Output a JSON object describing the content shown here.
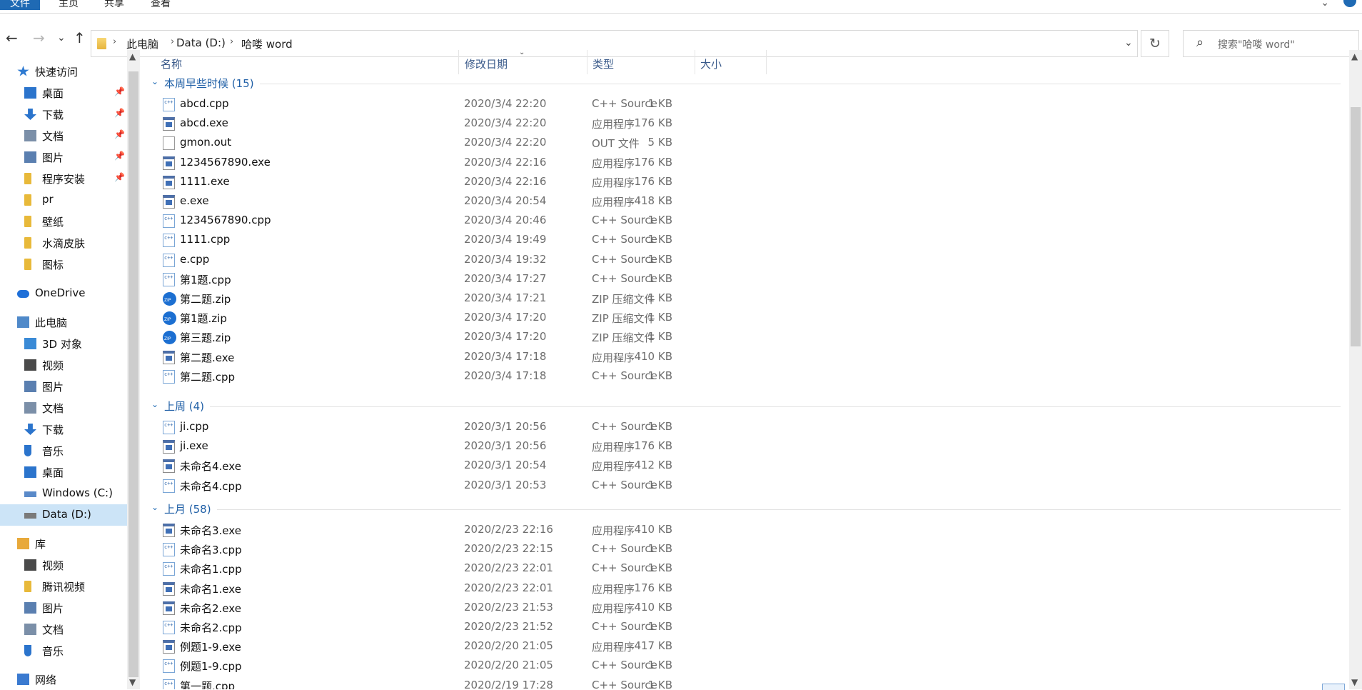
{
  "ribbon": {
    "tabs": [
      "文件",
      "主页",
      "共享",
      "查看"
    ],
    "expand_glyph": "⌄"
  },
  "nav": {
    "back": "←",
    "forward": "→",
    "recent": "⌄",
    "up": "↑",
    "breadcrumbs": [
      "此电脑",
      "Data (D:)",
      "哈喽 word"
    ],
    "separator": "›",
    "dropdown": "⌄",
    "refresh": "↻",
    "search_placeholder": "搜索\"哈喽 word\""
  },
  "navpane": {
    "scroll_up": "▲",
    "scroll_down": "▼",
    "items": [
      {
        "label": "快速访问",
        "icon": "star-icon",
        "level": 0,
        "color": "#2e7ad1"
      },
      {
        "label": "桌面",
        "icon": "desktop-icon",
        "level": 1,
        "pinned": true,
        "color": "#2b74cc"
      },
      {
        "label": "下载",
        "icon": "download-icon",
        "level": 1,
        "pinned": true,
        "color": "#2b74cc"
      },
      {
        "label": "文档",
        "icon": "document-icon",
        "level": 1,
        "pinned": true,
        "color": "#7b8fa8"
      },
      {
        "label": "图片",
        "icon": "picture-icon",
        "level": 1,
        "pinned": true,
        "color": "#5a7fb0"
      },
      {
        "label": "程序安装",
        "icon": "folder-icon",
        "level": 1,
        "pinned": true,
        "color": "#e8b93a"
      },
      {
        "label": "pr",
        "icon": "folder-icon",
        "level": 1,
        "color": "#e8b93a"
      },
      {
        "label": "壁纸",
        "icon": "folder-icon",
        "level": 1,
        "color": "#e8b93a"
      },
      {
        "label": "水滴皮肤",
        "icon": "folder-icon",
        "level": 1,
        "color": "#e8b93a"
      },
      {
        "label": "图标",
        "icon": "folder-icon",
        "level": 1,
        "color": "#e8b93a"
      },
      {
        "label": "OneDrive",
        "icon": "cloud-icon",
        "level": 0,
        "color": "#1e6fd8"
      },
      {
        "label": "此电脑",
        "icon": "computer-icon",
        "level": 0,
        "color": "#4f89c9"
      },
      {
        "label": "3D 对象",
        "icon": "cube-icon",
        "level": 1,
        "color": "#3a8ad6"
      },
      {
        "label": "视频",
        "icon": "video-icon",
        "level": 1,
        "color": "#4a4a4a"
      },
      {
        "label": "图片",
        "icon": "picture-icon",
        "level": 1,
        "color": "#5a7fb0"
      },
      {
        "label": "文档",
        "icon": "document-icon",
        "level": 1,
        "color": "#7b8fa8"
      },
      {
        "label": "下载",
        "icon": "download-icon",
        "level": 1,
        "color": "#2b74cc"
      },
      {
        "label": "音乐",
        "icon": "music-icon",
        "level": 1,
        "color": "#2b74cc"
      },
      {
        "label": "桌面",
        "icon": "desktop-icon",
        "level": 1,
        "color": "#2b74cc"
      },
      {
        "label": "Windows (C:)",
        "icon": "drive-icon",
        "level": 1,
        "color": "#5a8ac9"
      },
      {
        "label": "Data (D:)",
        "icon": "drive-icon",
        "level": 1,
        "selected": true,
        "color": "#7a7a7a"
      },
      {
        "label": "库",
        "icon": "library-icon",
        "level": 0,
        "color": "#e8a93a"
      },
      {
        "label": "视频",
        "icon": "video-icon",
        "level": 1,
        "color": "#4a4a4a"
      },
      {
        "label": "腾讯视频",
        "icon": "folder-icon",
        "level": 1,
        "color": "#e8b93a"
      },
      {
        "label": "图片",
        "icon": "picture-icon",
        "level": 1,
        "color": "#5a7fb0"
      },
      {
        "label": "文档",
        "icon": "document-icon",
        "level": 1,
        "color": "#7b8fa8"
      },
      {
        "label": "音乐",
        "icon": "music-icon",
        "level": 1,
        "color": "#2b74cc"
      },
      {
        "label": "网络",
        "icon": "network-icon",
        "level": 0,
        "color": "#3a7ad0"
      }
    ],
    "pin_glyph": "📌"
  },
  "columns": {
    "name": "名称",
    "date": "修改日期",
    "type": "类型",
    "size": "大小",
    "sort_glyph": "⌄"
  },
  "groups": [
    {
      "title": "本周早些时候 (15)",
      "chevron": "⌄",
      "files": [
        {
          "name": "abcd.cpp",
          "date": "2020/3/4 22:20",
          "type": "C++ Source",
          "size": "1 KB",
          "kind": "cpp"
        },
        {
          "name": "abcd.exe",
          "date": "2020/3/4 22:20",
          "type": "应用程序",
          "size": "176 KB",
          "kind": "exe"
        },
        {
          "name": "gmon.out",
          "date": "2020/3/4 22:20",
          "type": "OUT 文件",
          "size": "5 KB",
          "kind": "file"
        },
        {
          "name": "1234567890.exe",
          "date": "2020/3/4 22:16",
          "type": "应用程序",
          "size": "176 KB",
          "kind": "exe"
        },
        {
          "name": "1111.exe",
          "date": "2020/3/4 22:16",
          "type": "应用程序",
          "size": "176 KB",
          "kind": "exe"
        },
        {
          "name": "e.exe",
          "date": "2020/3/4 20:54",
          "type": "应用程序",
          "size": "418 KB",
          "kind": "exe"
        },
        {
          "name": "1234567890.cpp",
          "date": "2020/3/4 20:46",
          "type": "C++ Source",
          "size": "1 KB",
          "kind": "cpp"
        },
        {
          "name": "1111.cpp",
          "date": "2020/3/4 19:49",
          "type": "C++ Source",
          "size": "1 KB",
          "kind": "cpp"
        },
        {
          "name": "e.cpp",
          "date": "2020/3/4 19:32",
          "type": "C++ Source",
          "size": "1 KB",
          "kind": "cpp"
        },
        {
          "name": "第1题.cpp",
          "date": "2020/3/4 17:27",
          "type": "C++ Source",
          "size": "1 KB",
          "kind": "cpp"
        },
        {
          "name": "第二题.zip",
          "date": "2020/3/4 17:21",
          "type": "ZIP 压缩文件",
          "size": "1 KB",
          "kind": "zip"
        },
        {
          "name": "第1题.zip",
          "date": "2020/3/4 17:20",
          "type": "ZIP 压缩文件",
          "size": "1 KB",
          "kind": "zip"
        },
        {
          "name": "第三题.zip",
          "date": "2020/3/4 17:20",
          "type": "ZIP 压缩文件",
          "size": "1 KB",
          "kind": "zip"
        },
        {
          "name": "第二题.exe",
          "date": "2020/3/4 17:18",
          "type": "应用程序",
          "size": "410 KB",
          "kind": "exe"
        },
        {
          "name": "第二题.cpp",
          "date": "2020/3/4 17:18",
          "type": "C++ Source",
          "size": "1 KB",
          "kind": "cpp"
        }
      ]
    },
    {
      "title": "上周 (4)",
      "chevron": "⌄",
      "files": [
        {
          "name": "ji.cpp",
          "date": "2020/3/1 20:56",
          "type": "C++ Source",
          "size": "1 KB",
          "kind": "cpp"
        },
        {
          "name": "ji.exe",
          "date": "2020/3/1 20:56",
          "type": "应用程序",
          "size": "176 KB",
          "kind": "exe"
        },
        {
          "name": "未命名4.exe",
          "date": "2020/3/1 20:54",
          "type": "应用程序",
          "size": "412 KB",
          "kind": "exe"
        },
        {
          "name": "未命名4.cpp",
          "date": "2020/3/1 20:53",
          "type": "C++ Source",
          "size": "1 KB",
          "kind": "cpp"
        }
      ]
    },
    {
      "title": "上月 (58)",
      "chevron": "⌄",
      "files": [
        {
          "name": "未命名3.exe",
          "date": "2020/2/23 22:16",
          "type": "应用程序",
          "size": "410 KB",
          "kind": "exe"
        },
        {
          "name": "未命名3.cpp",
          "date": "2020/2/23 22:15",
          "type": "C++ Source",
          "size": "1 KB",
          "kind": "cpp"
        },
        {
          "name": "未命名1.cpp",
          "date": "2020/2/23 22:01",
          "type": "C++ Source",
          "size": "1 KB",
          "kind": "cpp"
        },
        {
          "name": "未命名1.exe",
          "date": "2020/2/23 22:01",
          "type": "应用程序",
          "size": "176 KB",
          "kind": "exe"
        },
        {
          "name": "未命名2.exe",
          "date": "2020/2/23 21:53",
          "type": "应用程序",
          "size": "410 KB",
          "kind": "exe"
        },
        {
          "name": "未命名2.cpp",
          "date": "2020/2/23 21:52",
          "type": "C++ Source",
          "size": "1 KB",
          "kind": "cpp"
        },
        {
          "name": "例题1-9.exe",
          "date": "2020/2/20 21:05",
          "type": "应用程序",
          "size": "417 KB",
          "kind": "exe"
        },
        {
          "name": "例题1-9.cpp",
          "date": "2020/2/20 21:05",
          "type": "C++ Source",
          "size": "1 KB",
          "kind": "cpp"
        },
        {
          "name": "第一题.cpp",
          "date": "2020/2/19 17:28",
          "type": "C++ Source",
          "size": "1 KB",
          "kind": "cpp"
        }
      ]
    }
  ],
  "scrollbar": {
    "up": "▲",
    "down": "▼"
  }
}
